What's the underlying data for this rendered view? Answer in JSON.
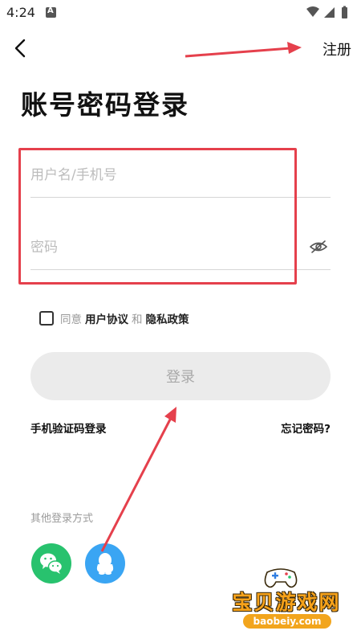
{
  "status_bar": {
    "time": "4:24"
  },
  "nav": {
    "register_label": "注册"
  },
  "page_title": "账号密码登录",
  "form": {
    "username_placeholder": "用户名/手机号",
    "username_value": "",
    "password_placeholder": "密码",
    "password_value": ""
  },
  "agreement": {
    "checked": false,
    "prefix": "同意",
    "user_agreement": "用户协议",
    "and": "和",
    "privacy_policy": "隐私政策"
  },
  "login_button": "登录",
  "links": {
    "sms_login": "手机验证码登录",
    "forgot_password": "忘记密码?"
  },
  "other_login": {
    "title": "其他登录方式",
    "methods": [
      {
        "icon": "wechat-icon"
      },
      {
        "icon": "qq-icon"
      }
    ]
  },
  "colors": {
    "highlight": "#e5404c",
    "wechat": "#28c26e",
    "qq": "#3aa5f3",
    "login_button_bg": "#ebebeb"
  },
  "watermark": {
    "brand": "宝贝游戏网",
    "url": "baobeiy.com"
  }
}
